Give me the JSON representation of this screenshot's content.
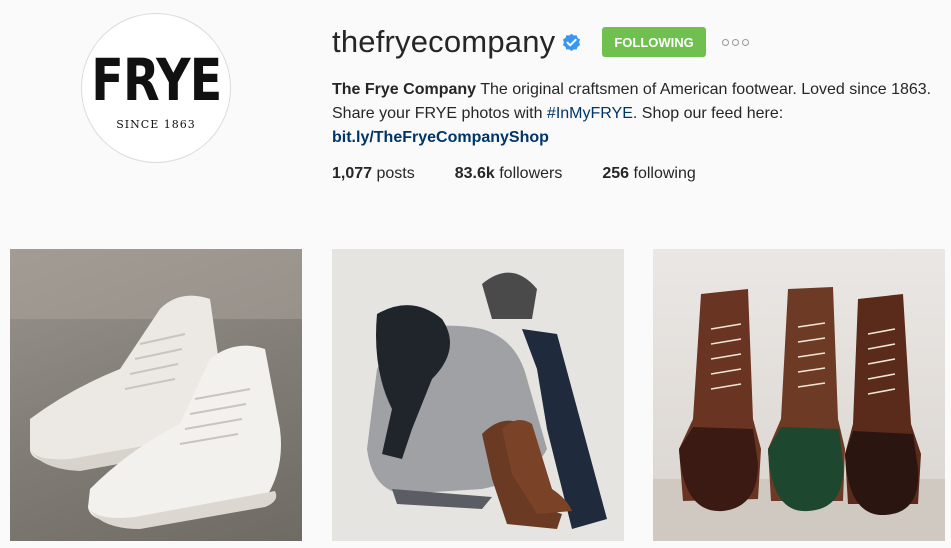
{
  "profile": {
    "avatar_logo_text": "FRYE",
    "avatar_logo_sub": "SINCE 1863",
    "username": "thefryecompany",
    "follow_button": "FOLLOWING",
    "bio_name": "The Frye Company",
    "bio_text_1": " The original craftsmen of American footwear. Loved since 1863. Share your FRYE photos with ",
    "bio_hashtag": "#InMyFRYE",
    "bio_text_2": ". Shop our feed here:",
    "bio_link": "bit.ly/TheFryeCompanyShop"
  },
  "stats": {
    "posts_count": "1,077",
    "posts_label": " posts",
    "followers_count": "83.6k",
    "followers_label": " followers",
    "following_count": "256",
    "following_label": " following"
  },
  "colors": {
    "follow_green": "#70c050",
    "verified_blue": "#3897f0",
    "link_blue": "#003569"
  },
  "icons": {
    "verified": "verified-badge-icon",
    "more": "more-options-icon"
  }
}
